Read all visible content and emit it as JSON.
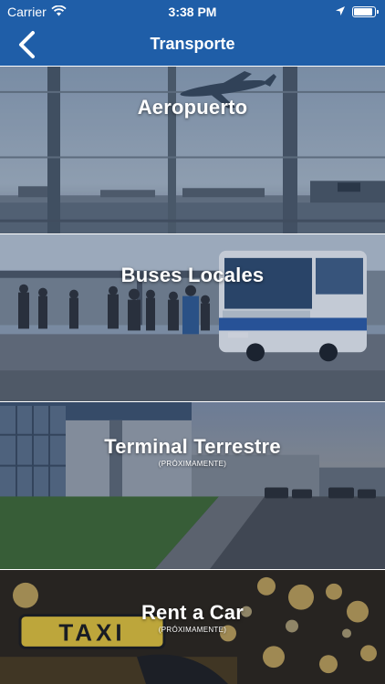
{
  "status_bar": {
    "carrier": "Carrier",
    "time": "3:38 PM",
    "battery_level": 0.95
  },
  "nav": {
    "title": "Transporte",
    "back_icon": "chevron-left-icon"
  },
  "tiles": [
    {
      "label": "Aeropuerto",
      "subtitle": ""
    },
    {
      "label": "Buses Locales",
      "subtitle": ""
    },
    {
      "label": "Terminal Terrestre",
      "subtitle": "(PRÓXIMAMENTE)"
    },
    {
      "label": "Rent a Car",
      "subtitle": "(PRÓXIMAMENTE)"
    }
  ],
  "colors": {
    "header": "#1f5ea8",
    "text": "#ffffff"
  }
}
